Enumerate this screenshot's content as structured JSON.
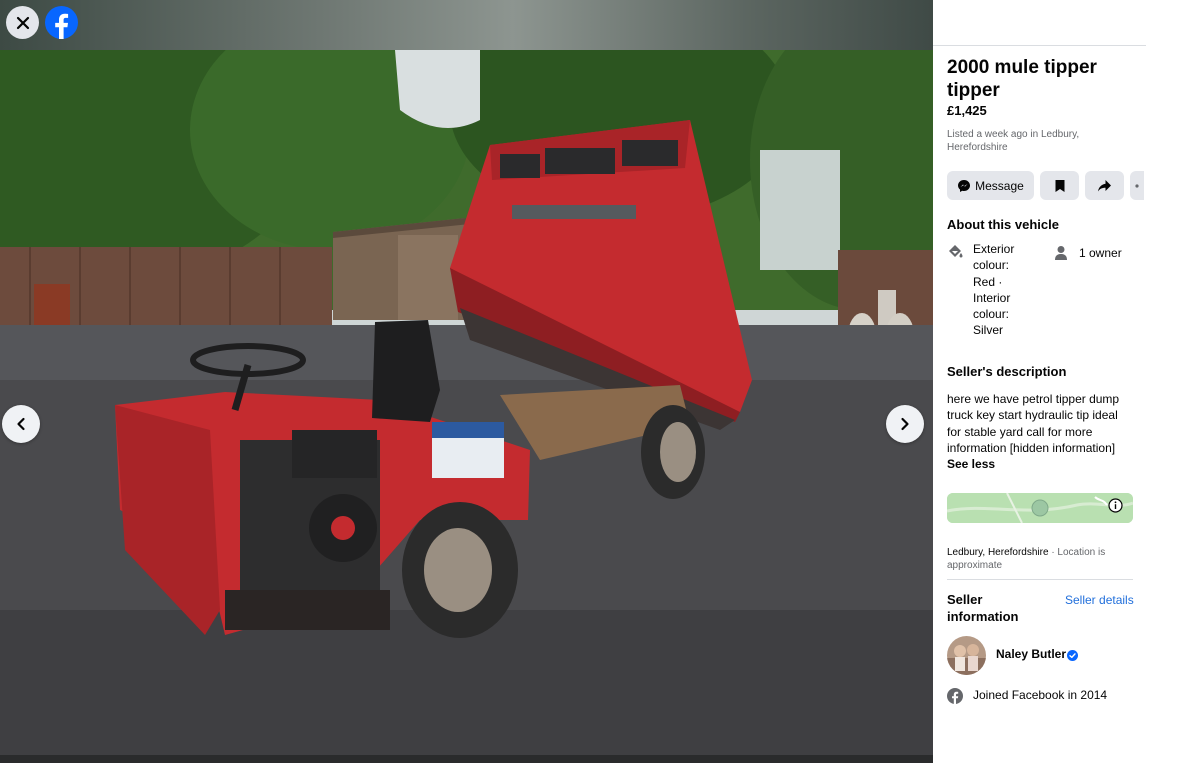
{
  "viewer": {
    "image_alt": "Red mule tipper on gravel",
    "close_label": "Close",
    "logo_label": "Facebook"
  },
  "listing": {
    "title": "2000 mule tipper tipper",
    "price": "£1,425",
    "listed": "Listed a week ago in Ledbury, Herefordshire"
  },
  "actions": {
    "message_label": "Message"
  },
  "about": {
    "heading": "About this vehicle",
    "colour_text": "Exterior colour: Red · Interior colour: Silver",
    "owners": "1 owner"
  },
  "description": {
    "heading": "Seller's description",
    "text": "here we have petrol tipper dump truck  key start hydraulic tip ideal for stable yard  call for more information [hidden information]",
    "toggle": "See less"
  },
  "location": {
    "place": "Ledbury, Herefordshire",
    "note": " · Location is approximate"
  },
  "seller": {
    "heading": "Seller information",
    "details_link": "Seller details",
    "name": "Naley Butler",
    "joined": "Joined Facebook in 2014"
  },
  "colors": {
    "accent": "#216fdb",
    "fb_blue": "#0866ff",
    "button_bg": "#e4e6eb"
  }
}
